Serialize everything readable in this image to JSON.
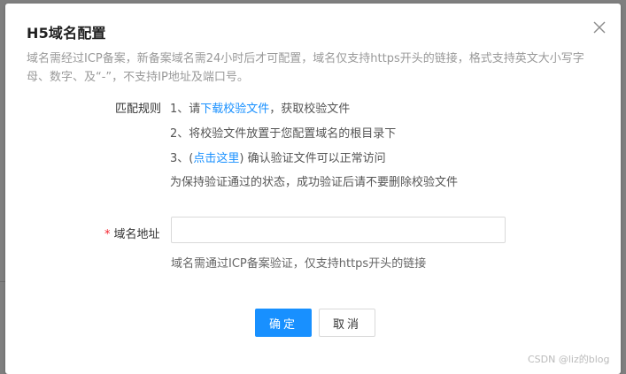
{
  "dialog": {
    "title": "H5域名配置",
    "description": "域名需经过ICP备案，新备案域名需24小时后才可配置，域名仅支持https开头的链接，格式支持英文大小写字母、数字、及“-”，不支持IP地址及端口号。",
    "rules": {
      "label": "匹配规则",
      "step1_prefix": "1、请",
      "step1_link": "下载校验文件",
      "step1_suffix": "，获取校验文件",
      "step2": "2、将校验文件放置于您配置域名的根目录下",
      "step3_prefix": "3、(",
      "step3_link": "点击这里",
      "step3_suffix": ") 确认验证文件可以正常访问",
      "note": "为保持验证通过的状态，成功验证后请不要删除校验文件"
    },
    "domain_field": {
      "required_mark": "*",
      "label": "域名地址",
      "value": "",
      "placeholder": "",
      "hint": "域名需通过ICP备案验证，仅支持https开头的链接"
    },
    "buttons": {
      "confirm": "确定",
      "cancel": "取消"
    },
    "close_icon": "close-icon"
  },
  "watermark": "CSDN @liz的blog",
  "colors": {
    "primary": "#1890ff",
    "required": "#f5222d",
    "muted_text": "#999999"
  }
}
